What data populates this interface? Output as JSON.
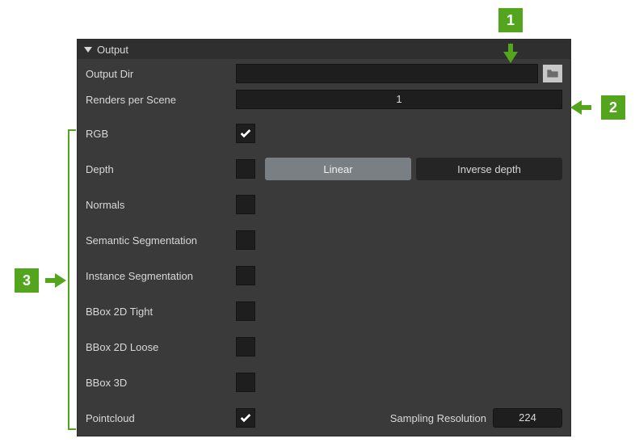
{
  "panel": {
    "title": "Output"
  },
  "fields": {
    "output_dir": {
      "label": "Output Dir",
      "value": ""
    },
    "renders_per_scene": {
      "label": "Renders per Scene",
      "value": "1"
    },
    "rgb": {
      "label": "RGB",
      "checked": true
    },
    "depth": {
      "label": "Depth",
      "checked": false,
      "option_linear": "Linear",
      "option_inverse": "Inverse depth",
      "selected": "Linear"
    },
    "normals": {
      "label": "Normals",
      "checked": false
    },
    "semantic_seg": {
      "label": "Semantic Segmentation",
      "checked": false
    },
    "instance_seg": {
      "label": "Instance Segmentation",
      "checked": false
    },
    "bbox2d_tight": {
      "label": "BBox 2D Tight",
      "checked": false
    },
    "bbox2d_loose": {
      "label": "BBox 2D Loose",
      "checked": false
    },
    "bbox3d": {
      "label": "BBox 3D",
      "checked": false
    },
    "pointcloud": {
      "label": "Pointcloud",
      "checked": true,
      "sampling_label": "Sampling Resolution",
      "sampling_value": "224"
    }
  },
  "callouts": {
    "c1": "1",
    "c2": "2",
    "c3": "3"
  }
}
